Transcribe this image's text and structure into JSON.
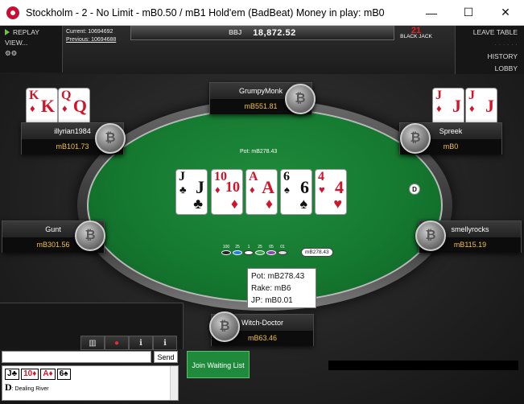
{
  "window": {
    "title": "Stockholm - 2 - No Limit - mB0.50 / mB1 Hold'em (BadBeat) Money in play: mB0",
    "min": "—",
    "max": "☐",
    "close": "✕"
  },
  "left_panel": {
    "replay": "REPLAY",
    "view": "VIEW...",
    "settings_glyph": "⚙⚙"
  },
  "hand_info": {
    "current": "Current: 10694692",
    "previous": "Previous: 10694688"
  },
  "center_display": {
    "label": "BBJ",
    "value": "18,872.52"
  },
  "badge": {
    "top": "21",
    "bottom": "BLACK JACK"
  },
  "right_menu": {
    "leave": "LEAVE TABLE",
    "blank": "· · · · · ·",
    "history": "HISTORY",
    "lobby": "LOBBY"
  },
  "pot_label": "Pot: mB278.43",
  "board": [
    {
      "rank": "J",
      "suit": "♣",
      "color": "black"
    },
    {
      "rank": "10",
      "suit": "♦",
      "color": "red"
    },
    {
      "rank": "A",
      "suit": "♦",
      "color": "red"
    },
    {
      "rank": "6",
      "suit": "♠",
      "color": "black"
    },
    {
      "rank": "4",
      "suit": "♥",
      "color": "red"
    }
  ],
  "hole_cards": {
    "illyrian": [
      {
        "rank": "K",
        "suit": "♦"
      },
      {
        "rank": "Q",
        "suit": "♦"
      }
    ],
    "spreek": [
      {
        "rank": "J",
        "suit": "♦"
      },
      {
        "rank": "J",
        "suit": "♦"
      }
    ]
  },
  "seats": {
    "grumpymonk": {
      "name": "GrumpyMonk",
      "stack": "mB551.81"
    },
    "illyrian": {
      "name": "illyrian1984",
      "stack": "mB101.73"
    },
    "spreek": {
      "name": "Spreek",
      "stack": "mB0"
    },
    "gunt": {
      "name": "Gunt",
      "stack": "mB301.56"
    },
    "smellyrocks": {
      "name": "smellyrocks",
      "stack": "mB115.19"
    },
    "witchdoctor": {
      "name": "Witch-Doctor",
      "stack": "mB63.46"
    }
  },
  "avatar_glyph": "₿",
  "dealer": "D",
  "chips": [
    "100",
    "25",
    "1",
    "25",
    "05",
    "01"
  ],
  "pot_pill": "mB278.43",
  "tooltip": {
    "pot": "Pot: mB278.43",
    "rake": "Rake: mB6",
    "jp": "JP: mB0.01"
  },
  "chat": {
    "input_value": "",
    "send": "Send",
    "tabs": [
      "▥",
      "●",
      "ℹ",
      "ℹ"
    ],
    "log_cards": [
      {
        "rank": "J",
        "suit": "♣",
        "color": "black"
      },
      {
        "rank": "10",
        "suit": "♦",
        "color": "red"
      },
      {
        "rank": "A",
        "suit": "♦",
        "color": "red"
      },
      {
        "rank": "6",
        "suit": "♠",
        "color": "black"
      }
    ],
    "log_d": "D",
    "log_text": ": Dealing River"
  },
  "waitlist": "Join Waiting List",
  "colors": {
    "felt": "#157a30",
    "stack": "#f0c040",
    "card_red": "#d2142a"
  }
}
